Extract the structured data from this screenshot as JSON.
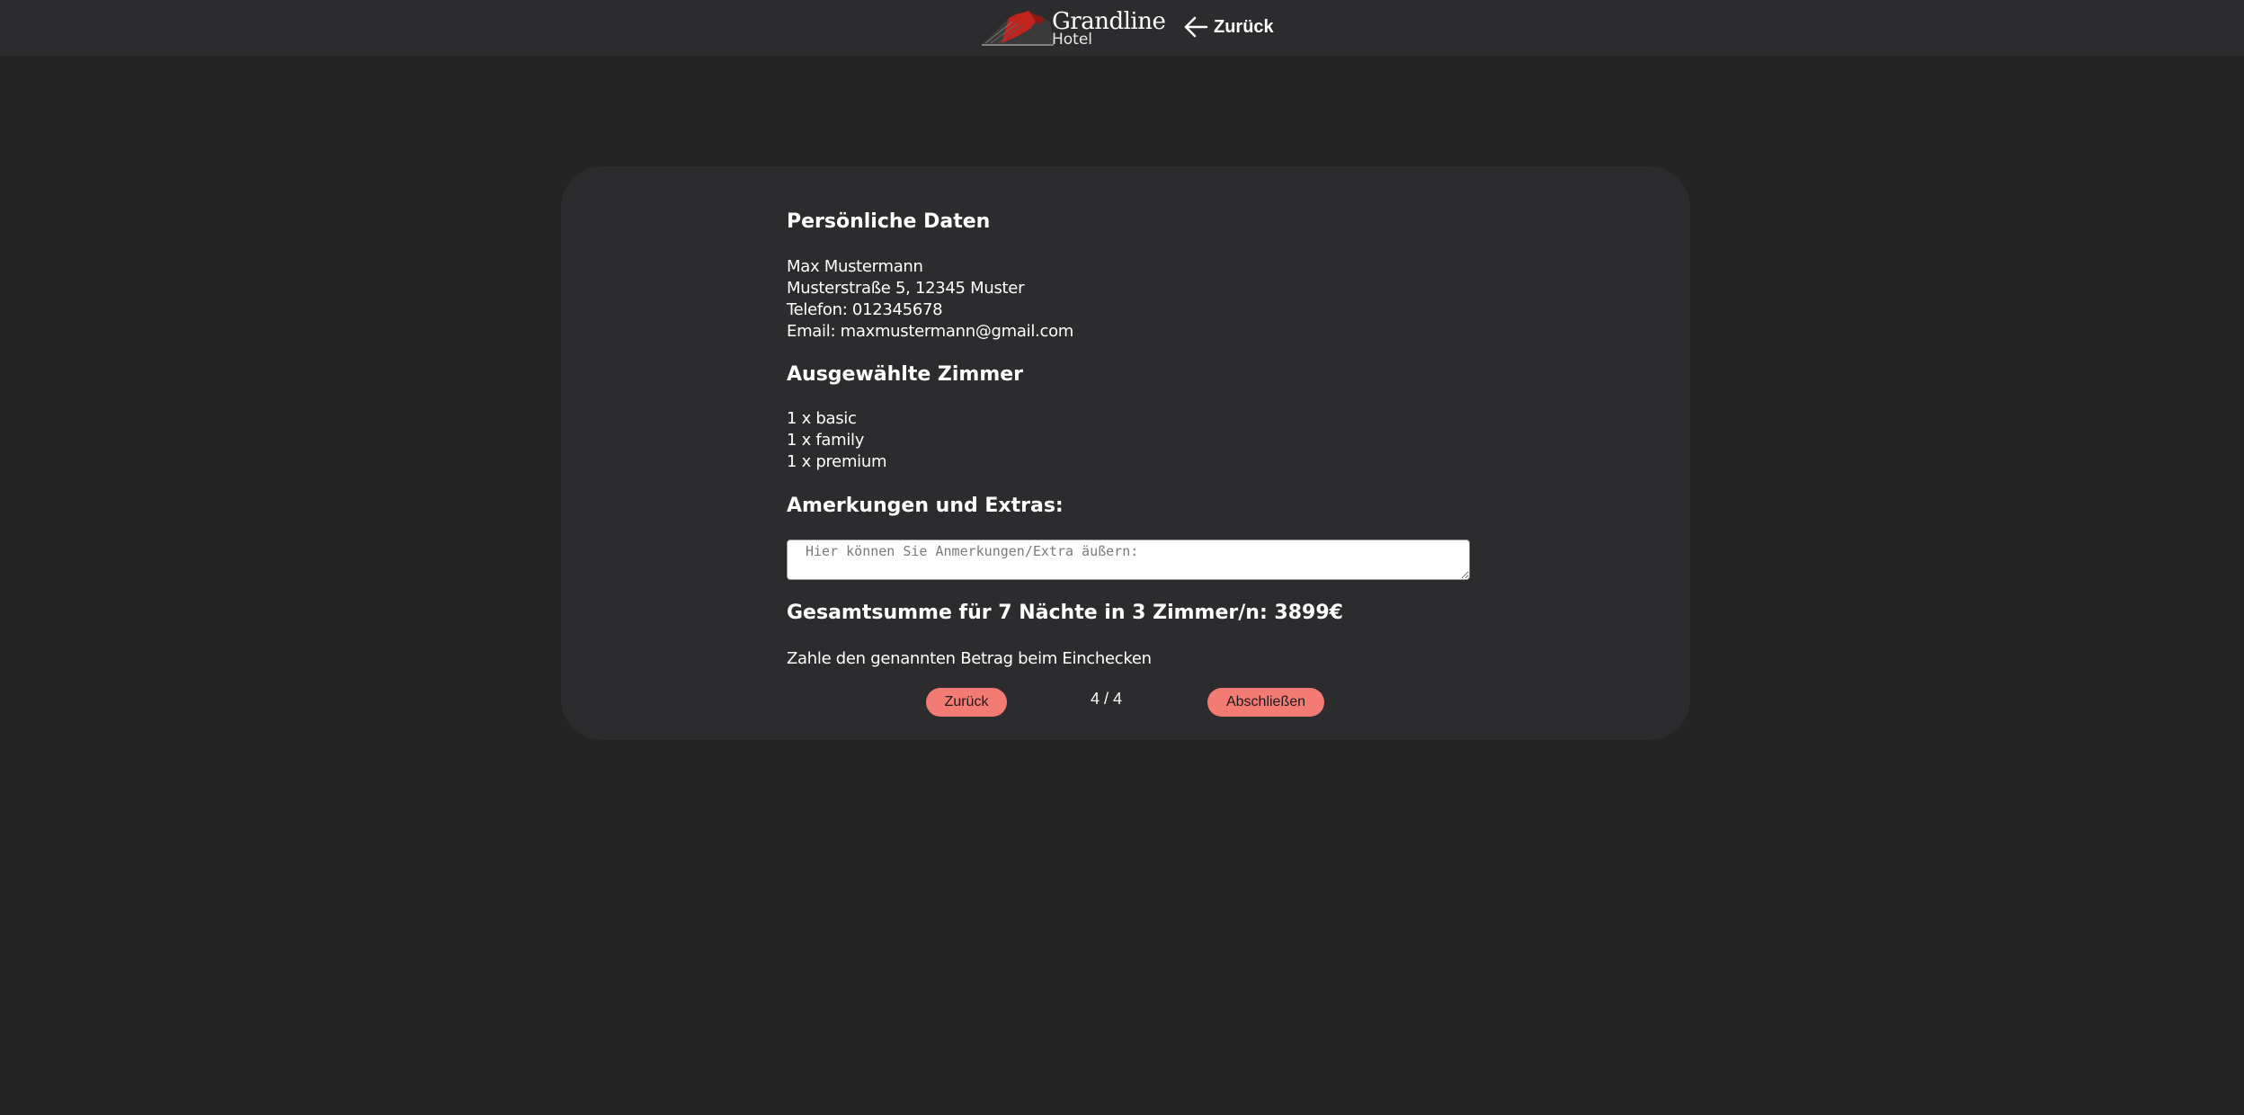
{
  "header": {
    "brand_name": "Grandline",
    "brand_sub": "Hotel",
    "back_label": "Zurück",
    "icons": {
      "logo": "mountain-logo-icon",
      "back": "arrow-left-icon"
    }
  },
  "summary": {
    "personal_heading": "Persönliche Daten",
    "name": "Max Mustermann",
    "address": "Musterstraße 5, 12345 Muster",
    "phone": "Telefon: 012345678",
    "email": "Email: maxmustermann@gmail.com",
    "rooms_heading": "Ausgewählte Zimmer",
    "rooms": [
      "1 x basic",
      "1 x family",
      "1 x premium"
    ],
    "remarks_heading": "Amerkungen und Extras:",
    "remarks_placeholder": "Hier können Sie Anmerkungen/Extra äußern:",
    "remarks_value": "",
    "total": "Gesamtsumme für 7 Nächte in 3 Zimmer/n: 3899€",
    "payment_note": "Zahle den genannten Betrag beim Einchecken"
  },
  "navigation": {
    "back_button": "Zurück",
    "step": "4 / 4",
    "finish_button": "Abschließen"
  },
  "colors": {
    "page_background": "#242424",
    "topbar": "#2c2c2e",
    "card": "#2c2c2f",
    "accent_button": "#f47a74",
    "logo_red": "#c0241c"
  }
}
